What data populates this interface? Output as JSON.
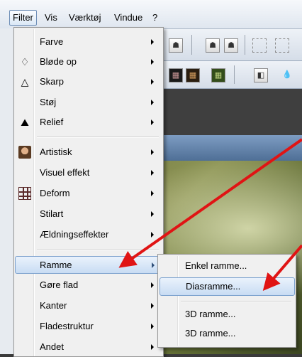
{
  "menubar": {
    "items": [
      "Filter",
      "Vis",
      "Værktøj",
      "Vindue",
      "?"
    ]
  },
  "filter_menu": {
    "items": [
      {
        "label": "Farve",
        "icon": "",
        "submenu": true
      },
      {
        "label": "Bløde op",
        "icon": "drop-outline-icon",
        "submenu": true
      },
      {
        "label": "Skarp",
        "icon": "triangle-drop-icon",
        "submenu": true
      },
      {
        "label": "Støj",
        "icon": "",
        "submenu": true
      },
      {
        "label": "Relief",
        "icon": "relief-icon",
        "submenu": true
      },
      {
        "label": "Artistisk",
        "icon": "portrait-icon",
        "submenu": true
      },
      {
        "label": "Visuel effekt",
        "icon": "",
        "submenu": true
      },
      {
        "label": "Deform",
        "icon": "grid-icon",
        "submenu": true
      },
      {
        "label": "Stilart",
        "icon": "",
        "submenu": true
      },
      {
        "label": "Ældningseffekter",
        "icon": "",
        "submenu": true
      },
      {
        "label": "Ramme",
        "icon": "",
        "submenu": true,
        "highlighted": true
      },
      {
        "label": "Gøre flad",
        "icon": "",
        "submenu": true
      },
      {
        "label": "Kanter",
        "icon": "",
        "submenu": true
      },
      {
        "label": "Fladestruktur",
        "icon": "",
        "submenu": true
      },
      {
        "label": "Andet",
        "icon": "",
        "submenu": true
      }
    ]
  },
  "ramme_submenu": {
    "items": [
      {
        "label": "Enkel ramme..."
      },
      {
        "label": "Diasramme...",
        "highlighted": true
      },
      {
        "label": "3D ramme..."
      },
      {
        "label": "3D ramme..."
      }
    ]
  },
  "colors": {
    "highlight_border": "#7da2ce",
    "annotation_arrow": "#e01414"
  }
}
